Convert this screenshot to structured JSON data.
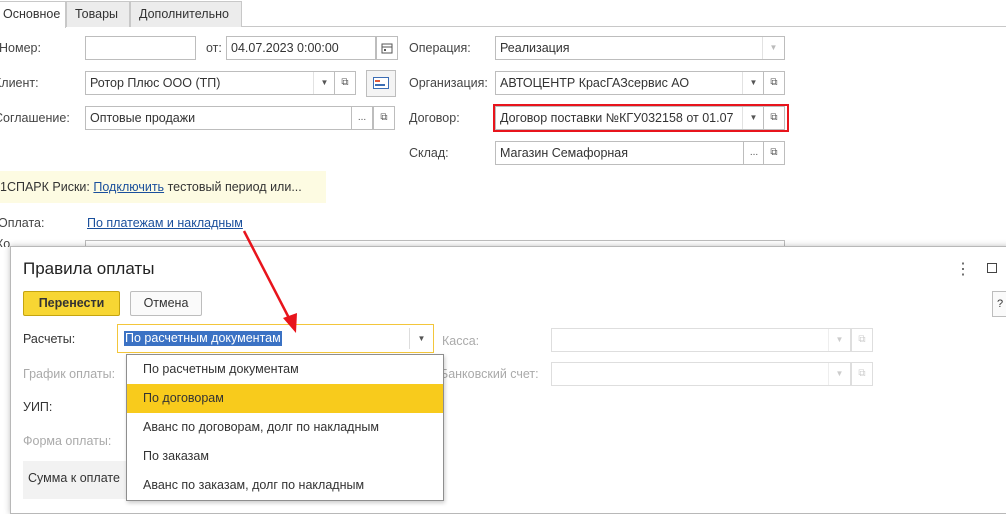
{
  "tabs": [
    "Основное",
    "Товары",
    "Дополнительно"
  ],
  "form": {
    "number_label": "Номер:",
    "number_value": "",
    "from_label": "от:",
    "date_value": "04.07.2023  0:00:00",
    "client_label": "Клиент:",
    "client_value": "Ротор Плюс ООО (ТП)",
    "agreement_label": "Соглашение:",
    "agreement_value": "Оптовые продажи",
    "operation_label": "Операция:",
    "operation_value": "Реализация",
    "organization_label": "Организация:",
    "organization_value": "АВТОЦЕНТР КрасГАЗсервис АО",
    "contract_label": "Договор:",
    "contract_value": "Договор поставки №КГУ032158 от 01.07",
    "warehouse_label": "Склад:",
    "warehouse_value": "Магазин Семафорная",
    "spark_prefix": "1СПАРК Риски:",
    "spark_link": "Подключить",
    "spark_suffix": "тестовый период или...",
    "payment_label": "Оплата:",
    "payment_link": "По платежам и накладным",
    "hidden_label": "Ко"
  },
  "dialog": {
    "title": "Правила оплаты",
    "ok_button": "Перенести",
    "cancel_button": "Отмена",
    "settlements_label": "Расчеты:",
    "settlements_value": "По расчетным документам",
    "schedule_label": "График оплаты:",
    "uip_label": "УИП:",
    "payment_form_label": "Форма оплаты:",
    "amount_label": "Сумма к оплате",
    "cash_label": "Касса:",
    "bank_label": "Банковский счет:",
    "options": [
      "По расчетным документам",
      "По договорам",
      "Аванс по договорам, долг по накладным",
      "По заказам",
      "Аванс по заказам, долг по накладным"
    ],
    "selected_option_index": 1
  },
  "colors": {
    "highlight_border": "#e8141c",
    "arrow": "#e8141c",
    "primary_button": "#f7d633",
    "selected_item": "#f8cb1c",
    "link": "#1a4f9c"
  }
}
